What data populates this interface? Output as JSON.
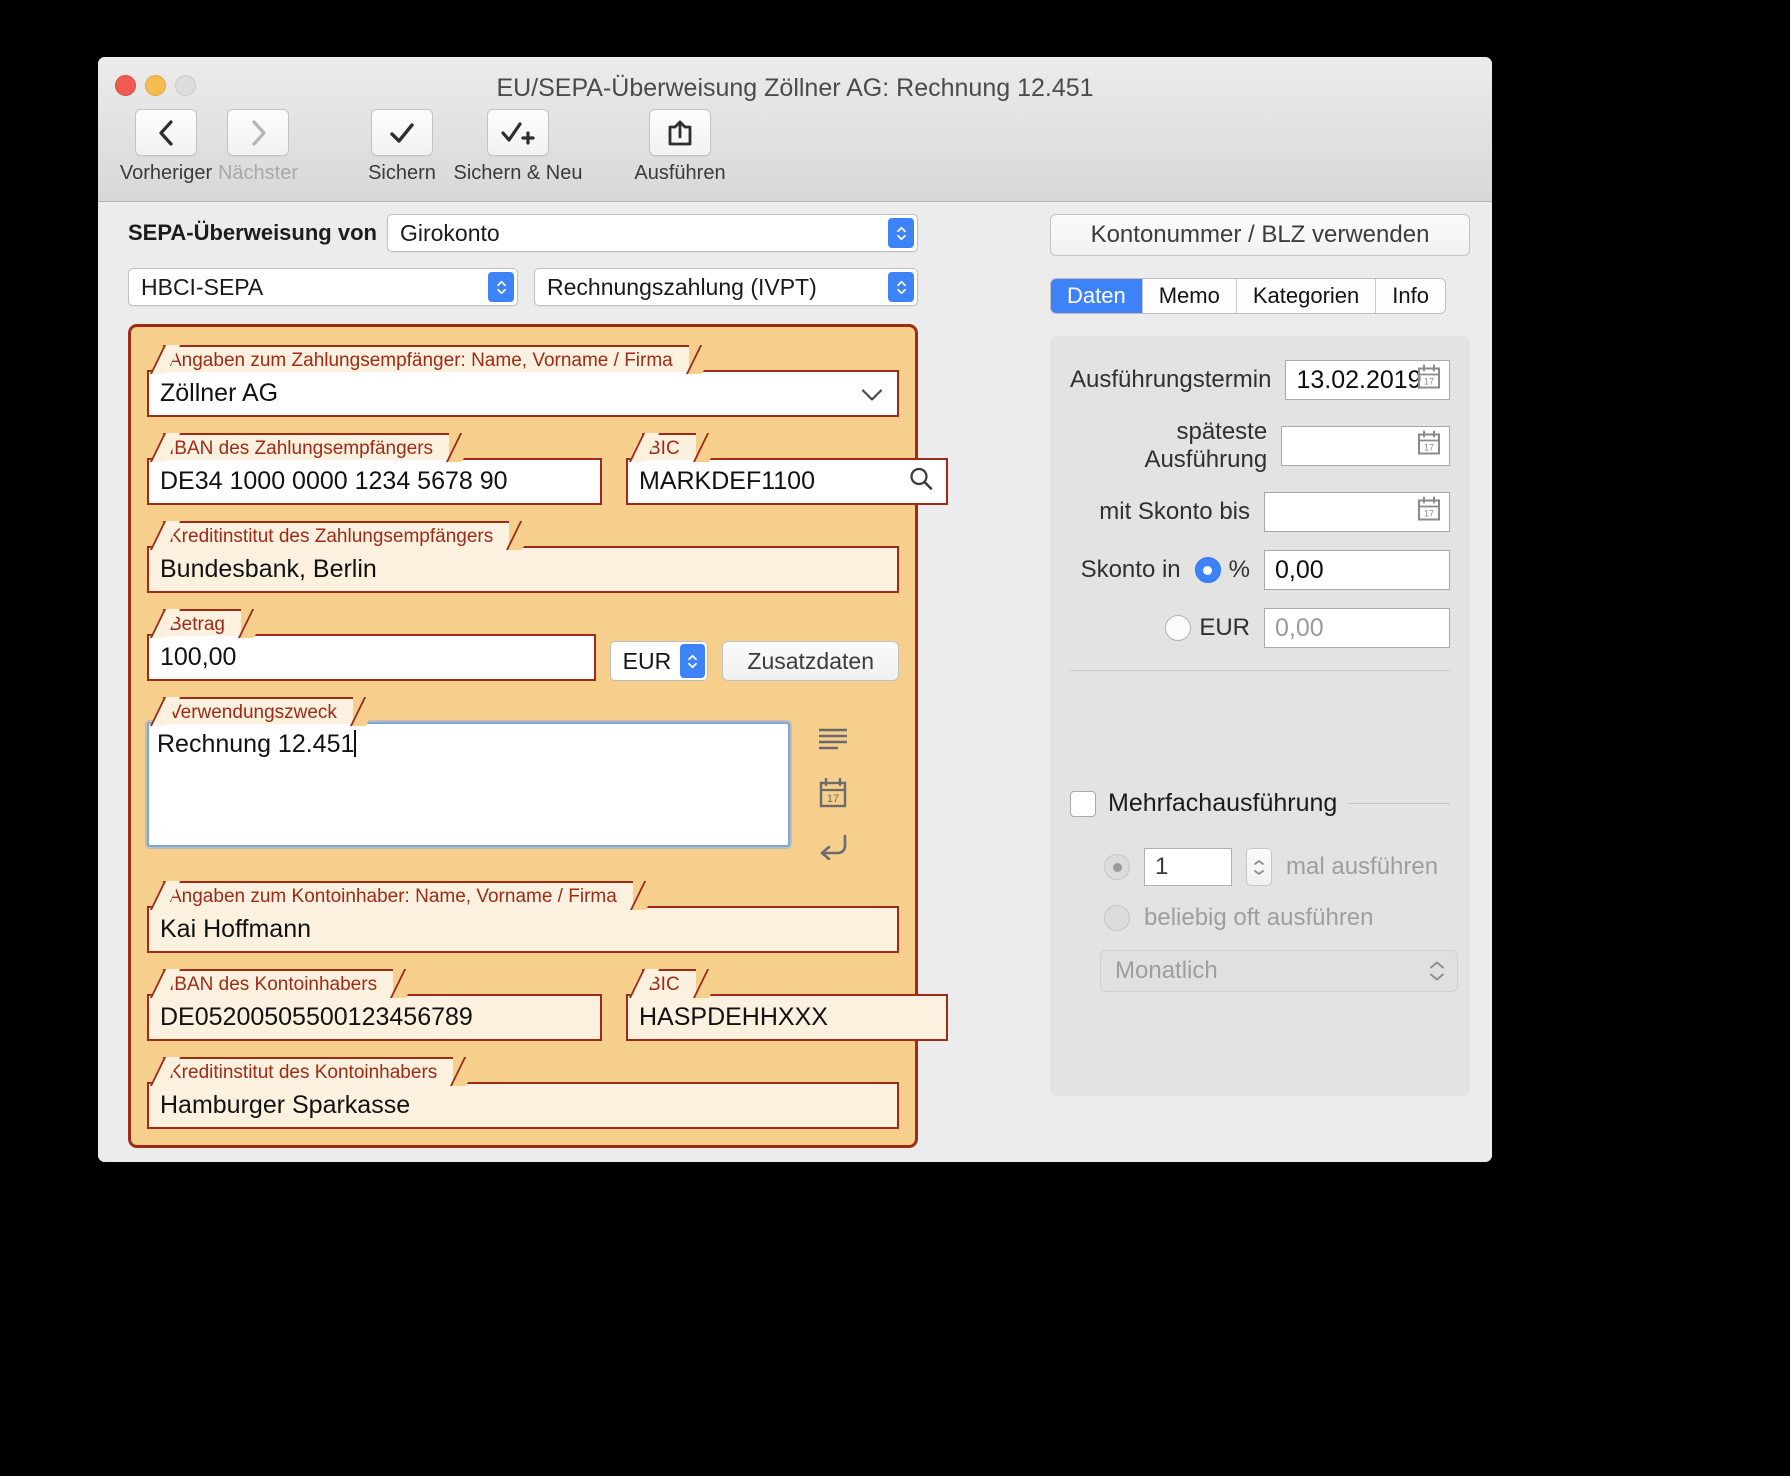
{
  "window": {
    "title": "EU/SEPA-Überweisung Zöllner AG: Rechnung 12.451"
  },
  "toolbar": {
    "items": [
      {
        "label": "Vorheriger",
        "icon": "chevron-left-icon",
        "enabled": true
      },
      {
        "label": "Nächster",
        "icon": "chevron-right-icon",
        "enabled": false
      },
      {
        "label": "Sichern",
        "icon": "checkmark-icon",
        "enabled": true
      },
      {
        "label": "Sichern & Neu",
        "icon": "checkmark-plus-icon",
        "enabled": true
      },
      {
        "label": "Ausführen",
        "icon": "share-export-icon",
        "enabled": true
      }
    ]
  },
  "form": {
    "source_label": "SEPA-Überweisung von",
    "source_account": "Girokonto",
    "method": "HBCI-SEPA",
    "payment_type": "Rechnungszahlung (IVPT)",
    "recipient": {
      "name_label": "Angaben zum Zahlungsempfänger: Name, Vorname / Firma",
      "name_value": "Zöllner AG",
      "iban_label": "IBAN des Zahlungsempfängers",
      "iban_value": "DE34 1000 0000 1234 5678 90",
      "bic_label": "BIC",
      "bic_value": "MARKDEF1100",
      "bank_label": "Kreditinstitut des Zahlungsempfängers",
      "bank_value": "Bundesbank, Berlin"
    },
    "amount": {
      "label": "Betrag",
      "value": "100,00",
      "currency": "EUR",
      "extra_button": "Zusatzdaten"
    },
    "purpose": {
      "label": "Verwendungszweck",
      "value": "Rechnung 12.451"
    },
    "holder": {
      "name_label": "Angaben zum Kontoinhaber: Name, Vorname / Firma",
      "name_value": "Kai Hoffmann",
      "iban_label": "IBAN des Kontoinhabers",
      "iban_value": "DE05200505500123456789",
      "bic_label": "BIC",
      "bic_value": "HASPDEHHXXX",
      "bank_label": "Kreditinstitut des Kontoinhabers",
      "bank_value": "Hamburger Sparkasse"
    }
  },
  "sidebar": {
    "use_account_button": "Kontonummer / BLZ verwenden",
    "tabs": [
      {
        "label": "Daten",
        "active": true
      },
      {
        "label": "Memo",
        "active": false
      },
      {
        "label": "Kategorien",
        "active": false
      },
      {
        "label": "Info",
        "active": false
      }
    ],
    "execution_date_label": "Ausführungstermin",
    "execution_date_value": "13.02.2019",
    "latest_execution_label": "späteste Ausführung",
    "latest_execution_value": "",
    "discount_until_label": "mit Skonto bis",
    "discount_until_value": "",
    "discount_in_label": "Skonto in",
    "discount_percent_label": "%",
    "discount_percent_value": "0,00",
    "discount_eur_label": "EUR",
    "discount_eur_value": "0,00",
    "multi_execution_label": "Mehrfachausführung",
    "times_value": "1",
    "times_label": "mal ausführen",
    "any_times_label": "beliebig oft ausführen",
    "interval_value": "Monatlich"
  },
  "colors": {
    "accent_blue": "#3e82f7",
    "panel_orange": "#f6cf8c",
    "panel_border_red": "#9e2a17",
    "label_text_red": "#9e2a17",
    "readonly_cream": "#fcf0de"
  }
}
